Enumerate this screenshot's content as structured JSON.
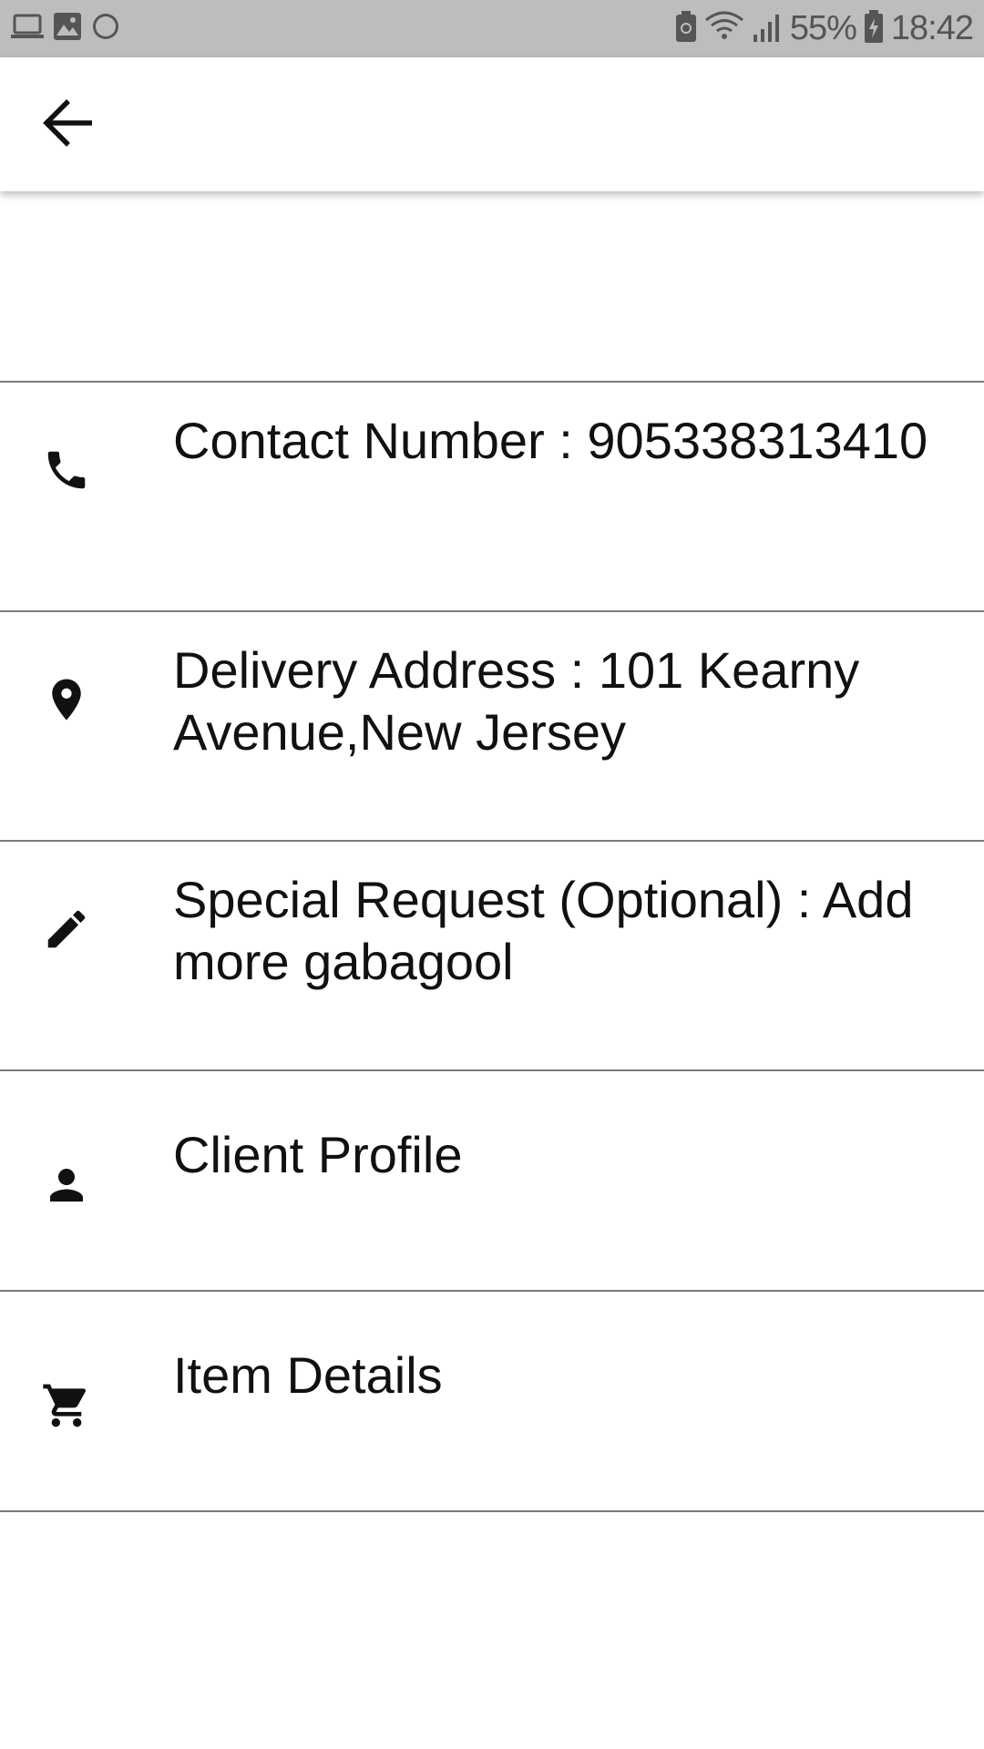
{
  "status_bar": {
    "battery_percent": "55%",
    "time": "18:42",
    "icons": [
      "laptop-icon",
      "image-icon",
      "moon-icon",
      "battery-saver-icon",
      "wifi-icon",
      "signal-icon",
      "battery-icon"
    ]
  },
  "app_bar": {
    "back_icon": "arrow-back-icon"
  },
  "rows": [
    {
      "icon": "phone-icon",
      "text": "Contact Number : 905338313410"
    },
    {
      "icon": "location-pin-icon",
      "text": "Delivery Address : 101 Kearny Avenue,New Jersey"
    },
    {
      "icon": "pencil-icon",
      "text": "Special Request (Optional) : Add more gabagool"
    },
    {
      "icon": "person-icon",
      "text": "Client Profile"
    },
    {
      "icon": "cart-icon",
      "text": "Item Details"
    }
  ]
}
